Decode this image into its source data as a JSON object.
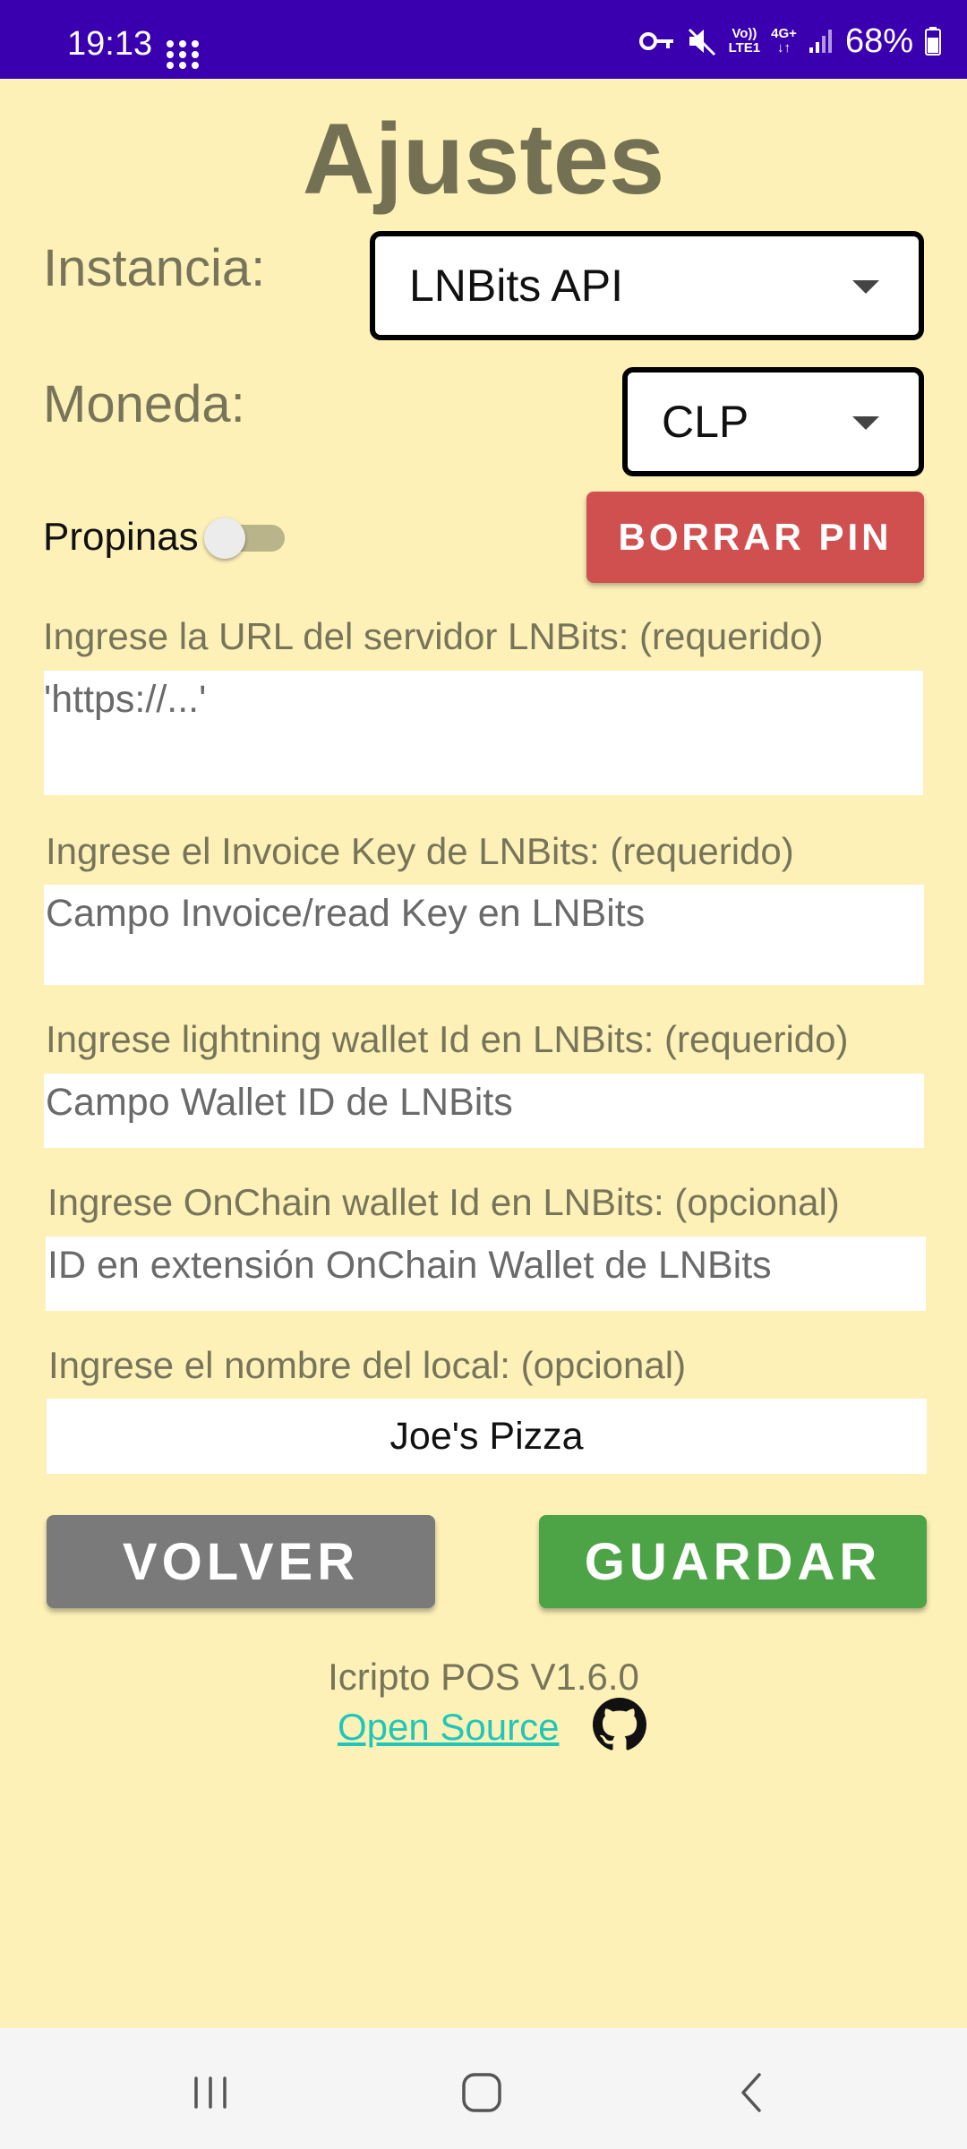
{
  "status_bar": {
    "time": "19:13",
    "lte_top": "Vo))",
    "lte_bottom": "LTE1",
    "net_top": "4G+",
    "battery": "68%"
  },
  "title": "Ajustes",
  "instancia": {
    "label": "Instancia:",
    "value": "LNBits API"
  },
  "moneda": {
    "label": "Moneda:",
    "value": "CLP"
  },
  "propinas": {
    "label": "Propinas",
    "enabled": false
  },
  "borrar_pin": "BORRAR PIN",
  "fields": [
    {
      "label": "Ingrese la URL del servidor LNBits: (requerido)",
      "placeholder": "'https://...'"
    },
    {
      "label": "Ingrese el Invoice Key de LNBits: (requerido)",
      "placeholder": "Campo Invoice/read Key en LNBits"
    },
    {
      "label": "Ingrese lightning wallet Id en LNBits: (requerido)",
      "placeholder": "Campo Wallet ID de LNBits"
    },
    {
      "label": "Ingrese OnChain wallet Id en LNBits: (opcional)",
      "placeholder": "ID en extensión OnChain Wallet de LNBits"
    },
    {
      "label": "Ingrese el nombre del local: (opcional)",
      "value": "Joe's Pizza"
    }
  ],
  "buttons": {
    "volver": "VOLVER",
    "guardar": "GUARDAR"
  },
  "footer": {
    "version": "Icripto POS V1.6.0",
    "link": "Open Source",
    "icon": "github-icon"
  },
  "colors": {
    "status_bar": "#3a00b0",
    "background": "#fdf1b8",
    "borrar": "#d05050",
    "volver": "#7a7a7a",
    "guardar": "#4ca446",
    "link": "#1fc7b8"
  }
}
